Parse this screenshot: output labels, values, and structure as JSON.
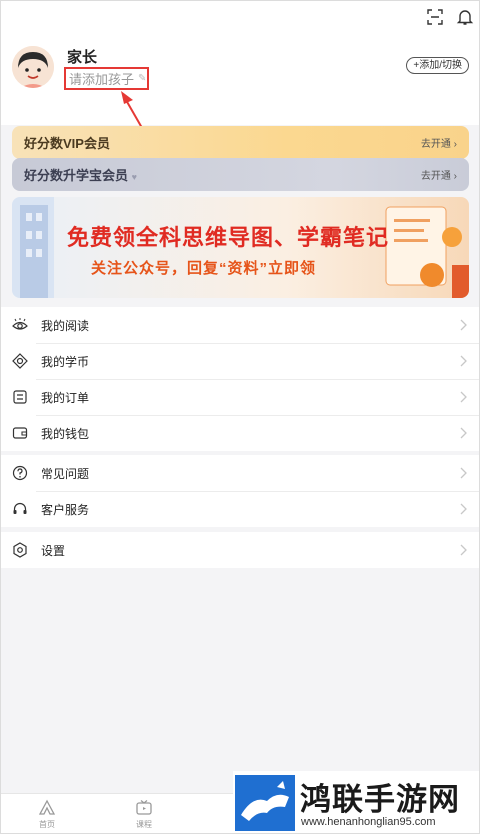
{
  "profile": {
    "name": "家长",
    "add_child_label": "请添加孩子",
    "switch_label": "+添加/切换"
  },
  "vip": [
    {
      "title": "好分数VIP会员",
      "action": "去开通"
    },
    {
      "title": "好分数升学宝会员",
      "action": "去开通"
    }
  ],
  "banner": {
    "line1": "免费领全科思维导图、学霸笔记",
    "line2": "关注公众号，回复“资料”立即领"
  },
  "menu_group1": [
    {
      "label": "我的阅读",
      "icon": "eye-icon"
    },
    {
      "label": "我的学币",
      "icon": "coin-icon"
    },
    {
      "label": "我的订单",
      "icon": "order-icon"
    },
    {
      "label": "我的钱包",
      "icon": "wallet-icon"
    }
  ],
  "menu_group2": [
    {
      "label": "常见问题",
      "icon": "question-icon"
    },
    {
      "label": "客户服务",
      "icon": "headset-icon"
    }
  ],
  "menu_group3": [
    {
      "label": "设置",
      "icon": "settings-icon"
    }
  ],
  "tabs": [
    {
      "label": "首页",
      "icon": "home-icon"
    },
    {
      "label": "课程",
      "icon": "tv-icon"
    }
  ],
  "watermark": {
    "title": "鸿联手游网",
    "url": "www.henanhonglian95.com"
  },
  "colors": {
    "highlight_box": "#e53935",
    "banner_red": "#e02b22",
    "vip_gold": "#f9d38b",
    "vip_silver": "#c9ccd8"
  }
}
